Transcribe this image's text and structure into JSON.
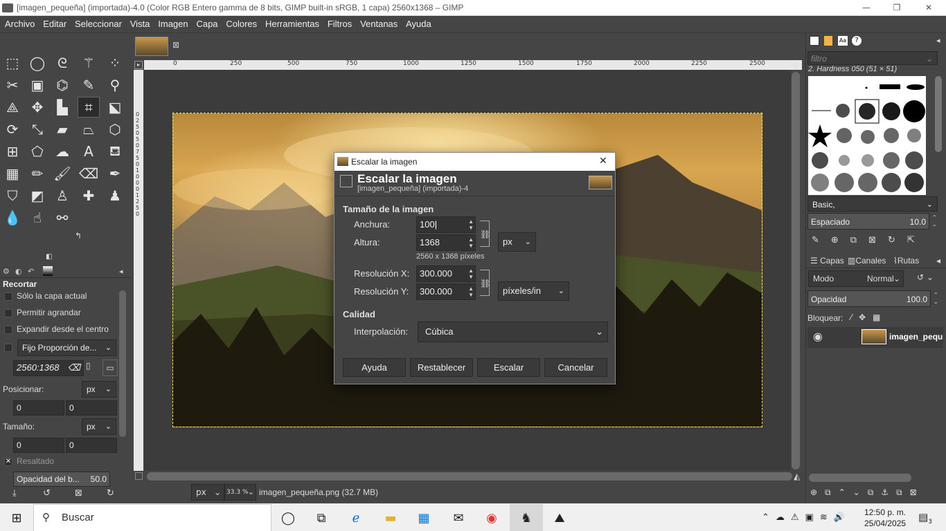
{
  "window": {
    "title": "[imagen_pequeña] (importada)-4.0 (Color RGB Entero gamma de 8 bits, GIMP built-in sRGB, 1 capa) 2560x1368 – GIMP",
    "minimize": "—",
    "maximize": "❐",
    "close": "✕"
  },
  "menu": [
    "Archivo",
    "Editar",
    "Seleccionar",
    "Vista",
    "Imagen",
    "Capa",
    "Colores",
    "Herramientas",
    "Filtros",
    "Ventanas",
    "Ayuda"
  ],
  "ruler": {
    "ticks": [
      "0",
      "250",
      "500",
      "750",
      "1000",
      "1250",
      "1500",
      "1750",
      "2000",
      "2250",
      "2500"
    ],
    "v_ticks": [
      "0",
      "2",
      "5",
      "0",
      "5",
      "0",
      "7",
      "5",
      "0",
      "1",
      "0",
      "0",
      "0",
      "1",
      "2",
      "5",
      "0"
    ]
  },
  "tool_options": {
    "title": "Recortar",
    "current_layer": "Sólo la capa actual",
    "allow_grow": "Permitir agrandar",
    "expand_center": "Expandir desde el centro",
    "fixed": "Fijo Proporción de...",
    "ratio": "2560:1368",
    "position_label": "Posicionar:",
    "position_unit": "px",
    "pos_x": "0",
    "pos_y": "0",
    "size_label": "Tamaño:",
    "size_unit": "px",
    "size_x": "0",
    "size_y": "0",
    "highlight": "Resaltado",
    "opacity_label": "Opacidad del b...",
    "opacity_value": "50.0"
  },
  "status": {
    "unit": "px",
    "zoom": "33.3 %",
    "file": "imagen_pequeña.png (32.7 MB)"
  },
  "dialog": {
    "window_title": "Escalar la imagen",
    "close": "✕",
    "heading": "Escalar la imagen",
    "subheading": "[imagen_pequeña] (importada)-4",
    "section_size": "Tamaño de la imagen",
    "width_label": "Anchura:",
    "width_value": "100",
    "height_label": "Altura:",
    "height_value": "1368",
    "unit": "px",
    "size_info": "2560 x 1368 píxeles",
    "resx_label": "Resolución X:",
    "resx_value": "300.000",
    "resy_label": "Resolución Y:",
    "resy_value": "300.000",
    "res_unit": "píxeles/in",
    "section_quality": "Calidad",
    "interp_label": "Interpolación:",
    "interp_value": "Cúbica",
    "buttons": {
      "help": "Ayuda",
      "reset": "Restablecer",
      "scale": "Escalar",
      "cancel": "Cancelar"
    }
  },
  "right": {
    "filter_placeholder": "filtro",
    "brush_name": "2. Hardness 050 (51 × 51)",
    "brush_set": "Basic,",
    "spacing_label": "Espaciado",
    "spacing_value": "10.0",
    "tabs": [
      "Capas",
      "Canales",
      "Rutas"
    ],
    "mode_label": "Modo",
    "mode_value": "Normal",
    "opacity_label": "Opacidad",
    "opacity_value": "100.0",
    "lock_label": "Bloquear:",
    "layer_name": "imagen_pequ"
  },
  "taskbar": {
    "search": "Buscar",
    "time": "12:50 p. m.",
    "date": "25/04/2025",
    "notifications": "3"
  },
  "colors": {
    "accent": "#ffea60",
    "bg": "#454545"
  }
}
